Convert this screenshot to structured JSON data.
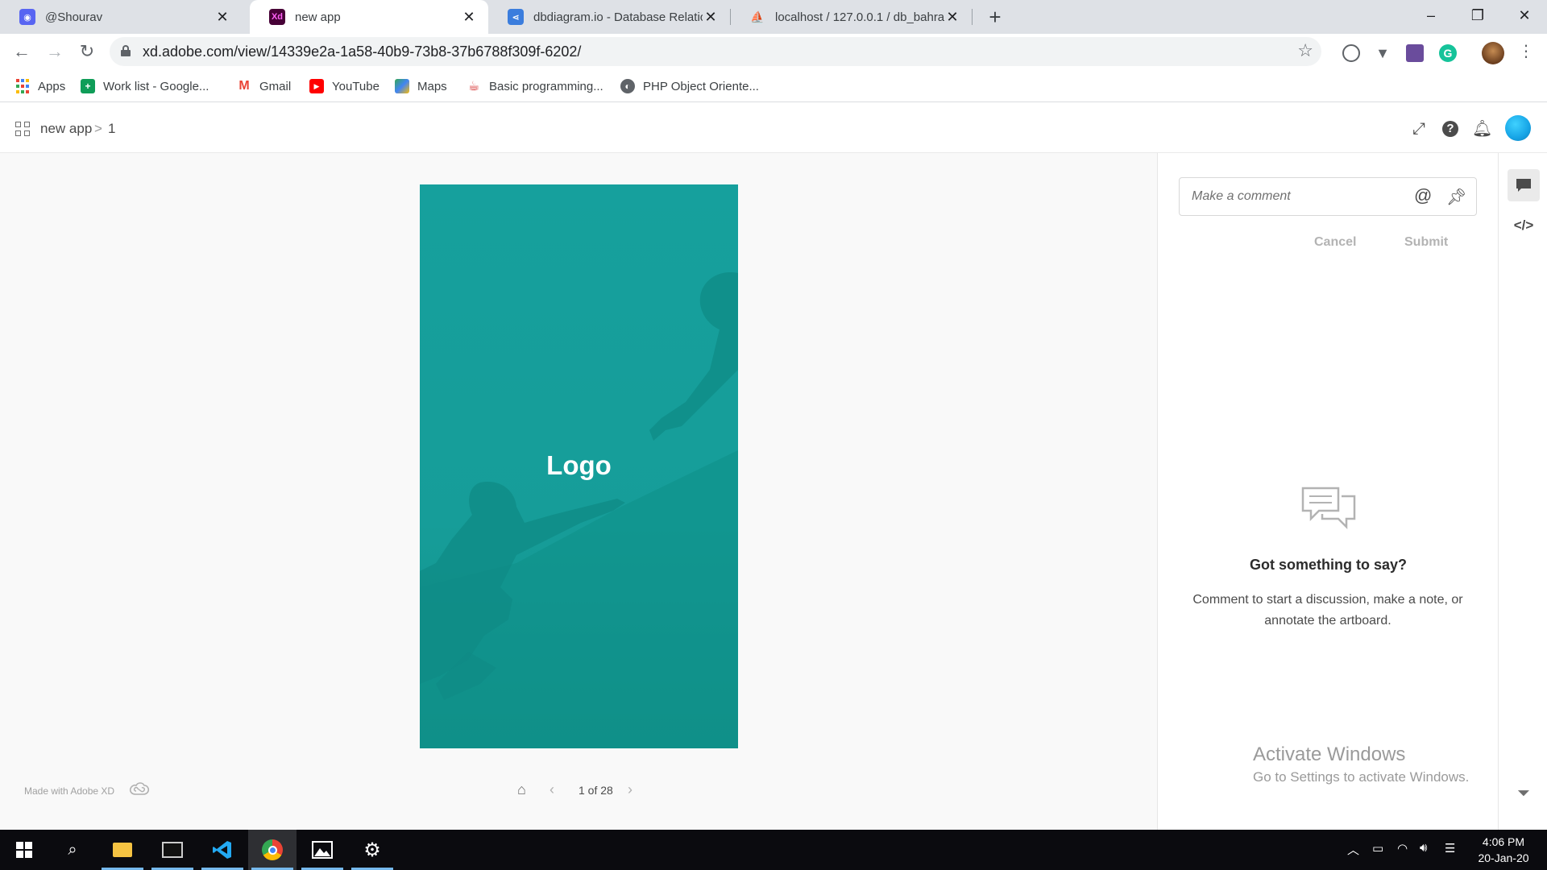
{
  "browser": {
    "tabs": [
      {
        "title": "@Shourav",
        "icon": "discord-icon",
        "active": false
      },
      {
        "title": "new app",
        "icon": "adobe-xd-icon",
        "active": true
      },
      {
        "title": "dbdiagram.io - Database Relation",
        "icon": "dbdiagram-icon",
        "active": false
      },
      {
        "title": "localhost / 127.0.0.1 / db_bahrain",
        "icon": "phpmyadmin-icon",
        "active": false
      }
    ],
    "new_tab": "+",
    "window_controls": {
      "minimize": "–",
      "restore": "❐",
      "close": "✕"
    },
    "url": "xd.adobe.com/view/14339e2a-1a58-40b9-73b8-37b6788f309f-6202/",
    "bookmarks": [
      {
        "label": "Apps",
        "icon": "apps-grid-icon"
      },
      {
        "label": "Work list - Google...",
        "icon": "google-sheets-icon"
      },
      {
        "label": "Gmail",
        "icon": "gmail-icon"
      },
      {
        "label": "YouTube",
        "icon": "youtube-icon"
      },
      {
        "label": "Maps",
        "icon": "maps-icon"
      },
      {
        "label": "Basic programming...",
        "icon": "java-icon"
      },
      {
        "label": "PHP Object Oriente...",
        "icon": "globe-icon"
      }
    ]
  },
  "xd": {
    "breadcrumb": {
      "project": "new app",
      "separator": ">",
      "page": "1"
    },
    "artboard": {
      "logo_text": "Logo",
      "colors": {
        "top": "#16a09d",
        "bottom": "#119089"
      }
    },
    "footer": {
      "made_with": "Made with Adobe XD",
      "pager": "1 of 28"
    },
    "comments": {
      "placeholder": "Make a comment",
      "at_symbol": "@",
      "cancel": "Cancel",
      "submit": "Submit",
      "empty_title": "Got something to say?",
      "empty_desc": "Comment to start a discussion, make a note, or annotate the artboard."
    },
    "rail": {
      "code_icon": "</>"
    },
    "activate_windows": {
      "title": "Activate Windows",
      "subtitle": "Go to Settings to activate Windows."
    }
  },
  "taskbar": {
    "time": "4:06 PM",
    "date": "20-Jan-20"
  },
  "colors": {
    "accent": "#1473e6",
    "teal": "#16a09d"
  }
}
